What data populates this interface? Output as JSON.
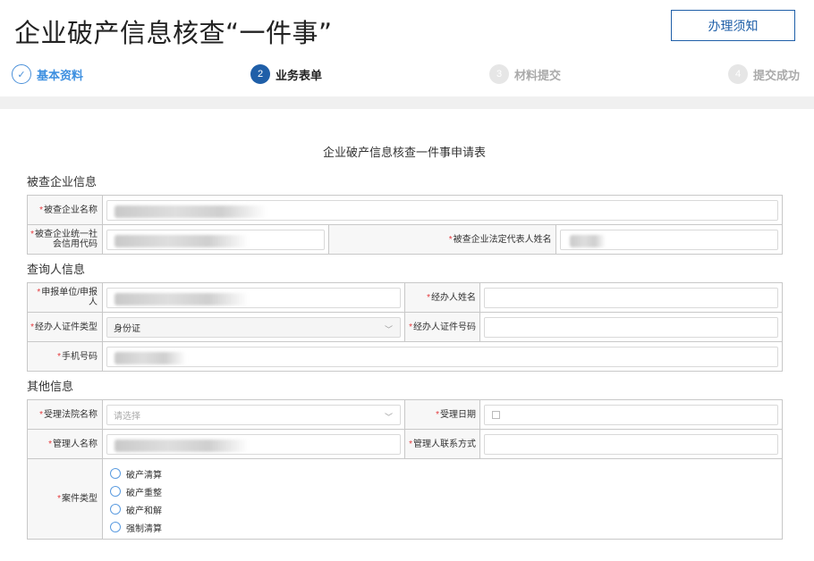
{
  "header": {
    "title": "企业破产信息核查“一件事”",
    "notice_button": "办理须知"
  },
  "steps": [
    {
      "num": "✓",
      "label": "基本资料",
      "state": "done"
    },
    {
      "num": "2",
      "label": "业务表单",
      "state": "active"
    },
    {
      "num": "3",
      "label": "材料提交",
      "state": "todo"
    },
    {
      "num": "4",
      "label": "提交成功",
      "state": "todo"
    }
  ],
  "form": {
    "heading": "企业破产信息核查一件事申请表",
    "required_mark": "*",
    "sections": {
      "company": {
        "title": "被查企业信息",
        "company_name_label": "被查企业名称",
        "credit_code_label": "被查企业统一社会信用代码",
        "legal_rep_label": "被查企业法定代表人姓名"
      },
      "inquirer": {
        "title": "查询人信息",
        "applicant_label": "申报单位/申报人",
        "agent_name_label": "经办人姓名",
        "id_type_label": "经办人证件类型",
        "id_type_value": "身份证",
        "id_number_label": "经办人证件号码",
        "phone_label": "手机号码"
      },
      "other": {
        "title": "其他信息",
        "court_label": "受理法院名称",
        "court_placeholder": "请选择",
        "accept_date_label": "受理日期",
        "manager_name_label": "管理人名称",
        "manager_contact_label": "管理人联系方式",
        "case_type_label": "案件类型",
        "case_types": [
          "破产清算",
          "破产重整",
          "破产和解",
          "强制清算"
        ]
      }
    }
  },
  "colors": {
    "primary": "#1f5fa8",
    "done_step": "#3d8fe0",
    "required": "#e4393c"
  }
}
